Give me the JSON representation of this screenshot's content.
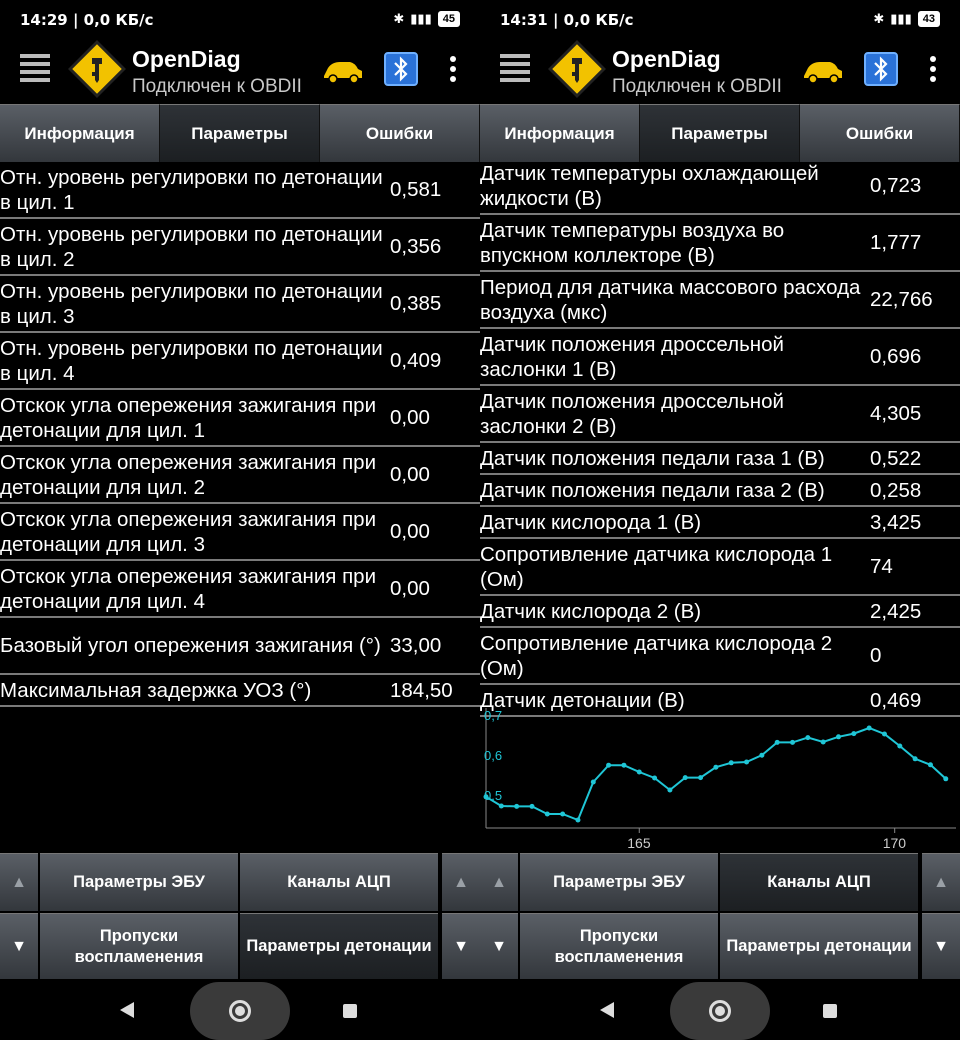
{
  "colors": {
    "chart_line": "#1fc6d6",
    "tab_bg": "#464a50",
    "divider": "#7a7a7a"
  },
  "left": {
    "status": {
      "time": "14:29 | 0,0 КБ/с",
      "battery": "45"
    },
    "app": {
      "title": "OpenDiag",
      "subtitle": "Подключен к OBDII"
    },
    "tabs": [
      "Информация",
      "Параметры",
      "Ошибки"
    ],
    "active_tab": 1,
    "rows": [
      {
        "name": "Отн. уровень регулировки по детонации в цил. 1",
        "value": "0,581",
        "lines": 2
      },
      {
        "name": "Отн. уровень регулировки по детонации в цил. 2",
        "value": "0,356",
        "lines": 2
      },
      {
        "name": "Отн. уровень регулировки по детонации в цил. 3",
        "value": "0,385",
        "lines": 2
      },
      {
        "name": "Отн. уровень регулировки по детонации в цил. 4",
        "value": "0,409",
        "lines": 2
      },
      {
        "name": "Отскок угла опережения зажигания при детонации для цил. 1",
        "value": "0,00",
        "lines": 2
      },
      {
        "name": "Отскок угла опережения зажигания при детонации для цил. 2",
        "value": "0,00",
        "lines": 2
      },
      {
        "name": "Отскок угла опережения зажигания при детонации для цил. 3",
        "value": "0,00",
        "lines": 2
      },
      {
        "name": "Отскок угла опережения зажигания при детонации для цил. 4",
        "value": "0,00",
        "lines": 2
      },
      {
        "name": "Базовый угол опережения зажигания (°)",
        "value": "33,00",
        "lines": 2
      },
      {
        "name": "Максимальная задержка УОЗ (°)",
        "value": "184,50",
        "lines": 1
      }
    ],
    "bottom": {
      "ecu_params": "Параметры ЭБУ",
      "adc_channels": "Каналы АЦП",
      "misfires": "Пропуски воспламенения",
      "knock_params": "Параметры детонации",
      "active": "knock_params"
    }
  },
  "right": {
    "status": {
      "time": "14:31 | 0,0 КБ/с",
      "battery": "43"
    },
    "app": {
      "title": "OpenDiag",
      "subtitle": "Подключен к OBDII"
    },
    "tabs": [
      "Информация",
      "Параметры",
      "Ошибки"
    ],
    "active_tab": 1,
    "rows": [
      {
        "name": "Датчик температуры охлаждающей жидкости (В)",
        "value": "0,723",
        "lines": 2
      },
      {
        "name": "Датчик температуры воздуха во впускном коллекторе (В)",
        "value": "1,777",
        "lines": 2
      },
      {
        "name": "Период для датчика массового расхода воздуха (мкс)",
        "value": "22,766",
        "lines": 2
      },
      {
        "name": "Датчик положения дроссельной заслонки 1 (В)",
        "value": "0,696",
        "lines": 2
      },
      {
        "name": "Датчик положения дроссельной заслонки 2 (В)",
        "value": "4,305",
        "lines": 2
      },
      {
        "name": "Датчик положения педали газа 1 (В)",
        "value": "0,522",
        "lines": 1
      },
      {
        "name": "Датчик положения педали газа 2 (В)",
        "value": "0,258",
        "lines": 1
      },
      {
        "name": "Датчик кислорода 1 (В)",
        "value": "3,425",
        "lines": 1
      },
      {
        "name": "Сопротивление датчика кислорода 1 (Ом)",
        "value": "74",
        "lines": 2
      },
      {
        "name": "Датчик кислорода 2 (В)",
        "value": "2,425",
        "lines": 1
      },
      {
        "name": "Сопротивление датчика кислорода 2 (Ом)",
        "value": "0",
        "lines": 2
      },
      {
        "name": "Датчик детонации (В)",
        "value": "0,469",
        "lines": 1
      }
    ],
    "bottom": {
      "ecu_params": "Параметры ЭБУ",
      "adc_channels": "Каналы АЦП",
      "misfires": "Пропуски воспламенения",
      "knock_params": "Параметры детонации",
      "active": "adc_channels"
    }
  },
  "chart_data": {
    "type": "line",
    "title": "",
    "xlabel": "",
    "ylabel": "",
    "x_ticks": [
      165,
      170
    ],
    "y_ticks": [
      "0,5",
      "0,6",
      "0,7"
    ],
    "xlim": [
      162.0,
      171.2
    ],
    "ylim": [
      0.42,
      0.72
    ],
    "x": [
      162.0,
      162.3,
      162.6,
      162.9,
      163.2,
      163.5,
      163.8,
      164.1,
      164.4,
      164.7,
      165.0,
      165.3,
      165.6,
      165.9,
      166.2,
      166.5,
      166.8,
      167.1,
      167.4,
      167.7,
      168.0,
      168.3,
      168.6,
      168.9,
      169.2,
      169.5,
      169.8,
      170.1,
      170.4,
      170.7,
      171.0
    ],
    "values": [
      0.498,
      0.475,
      0.474,
      0.474,
      0.455,
      0.455,
      0.44,
      0.535,
      0.577,
      0.577,
      0.56,
      0.545,
      0.515,
      0.546,
      0.546,
      0.572,
      0.583,
      0.585,
      0.602,
      0.634,
      0.634,
      0.646,
      0.635,
      0.648,
      0.656,
      0.67,
      0.655,
      0.625,
      0.593,
      0.578,
      0.543
    ]
  }
}
